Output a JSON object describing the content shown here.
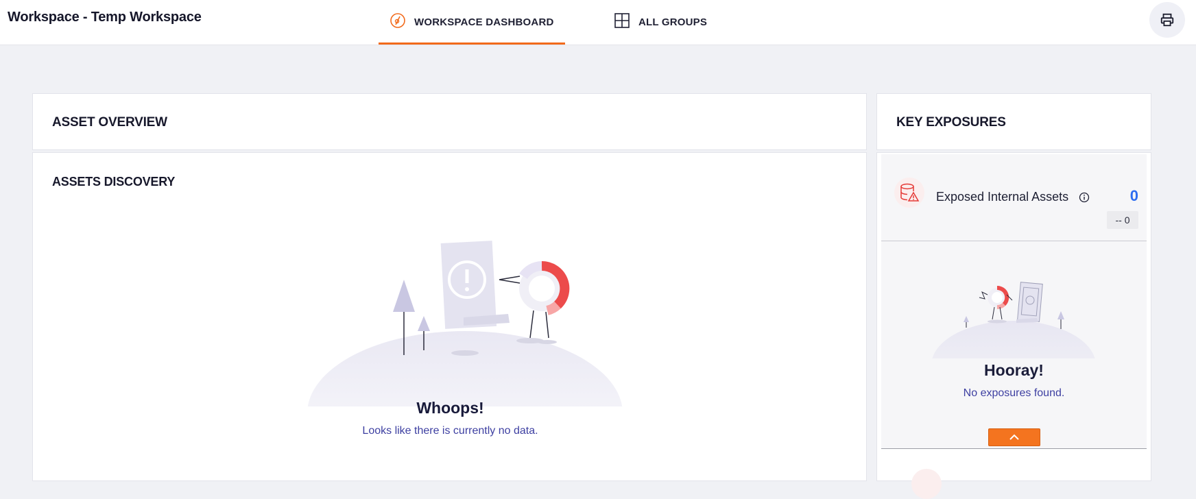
{
  "header": {
    "workspace_title": "Workspace - Temp Workspace",
    "tabs": [
      {
        "label": "WORKSPACE DASHBOARD",
        "icon": "dashboard-icon",
        "active": true
      },
      {
        "label": "ALL GROUPS",
        "icon": "grid-icon",
        "active": false
      }
    ],
    "print_icon": "printer-icon"
  },
  "colors": {
    "accent": "#f26a1b",
    "count_blue": "#2d6df0",
    "danger_red": "#e53935",
    "subtext_purple": "#3d3fa1"
  },
  "asset_overview": {
    "title": "ASSET OVERVIEW"
  },
  "assets_discovery": {
    "title": "ASSETS DISCOVERY",
    "empty_title": "Whoops!",
    "empty_message": "Looks like there is currently no data."
  },
  "key_exposures": {
    "title": "KEY EXPOSURES",
    "items": [
      {
        "label": "Exposed Internal Assets",
        "icon": "database-warning-icon",
        "count": "0",
        "delta": "-- 0"
      }
    ],
    "empty_title": "Hooray!",
    "empty_message": "No exposures found."
  }
}
